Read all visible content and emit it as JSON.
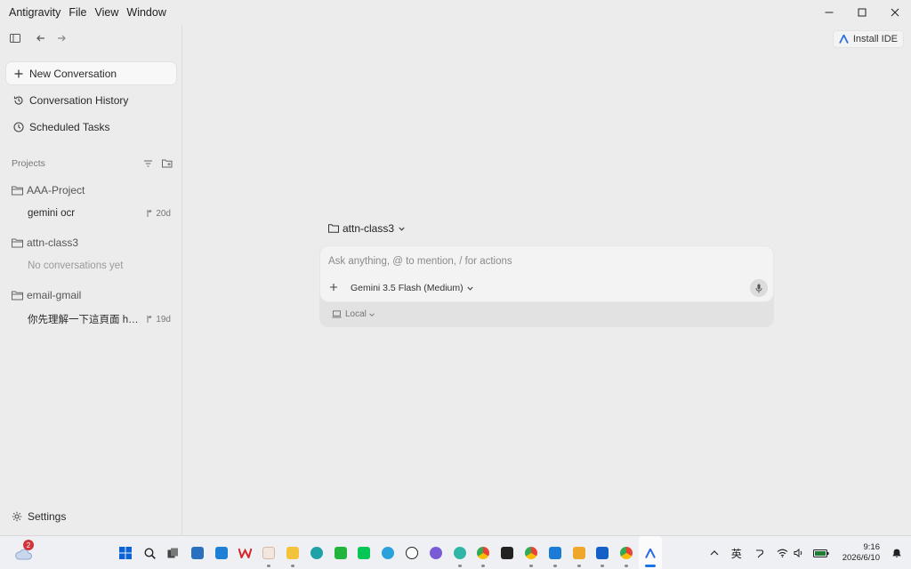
{
  "window": {
    "menu": [
      "Antigravity",
      "File",
      "View",
      "Window"
    ]
  },
  "sidebar": {
    "nav": [
      {
        "label": "New Conversation"
      },
      {
        "label": "Conversation History"
      },
      {
        "label": "Scheduled Tasks"
      }
    ],
    "projects_label": "Projects",
    "projects": [
      {
        "name": "AAA-Project",
        "conversations": [
          {
            "title": "gemini ocr",
            "age": "20d"
          }
        ]
      },
      {
        "name": "attn-class3",
        "empty_text": "No conversations yet"
      },
      {
        "name": "email-gmail",
        "conversations": [
          {
            "title": "你先理解一下這頁面 ht...",
            "age": "19d"
          }
        ]
      }
    ],
    "settings_label": "Settings"
  },
  "main": {
    "install_label": "Install IDE",
    "folder": "attn-class3",
    "composer": {
      "placeholder": "Ask anything, @ to mention, / for actions",
      "model": "Gemini 3.5 Flash (Medium)",
      "env": "Local"
    }
  },
  "taskbar": {
    "notification_count": "2",
    "ime": "英",
    "time": "9:16",
    "date": "2026/6/10"
  },
  "colors": {
    "window_bg": "#ececec",
    "accent": "#1a73e8"
  }
}
